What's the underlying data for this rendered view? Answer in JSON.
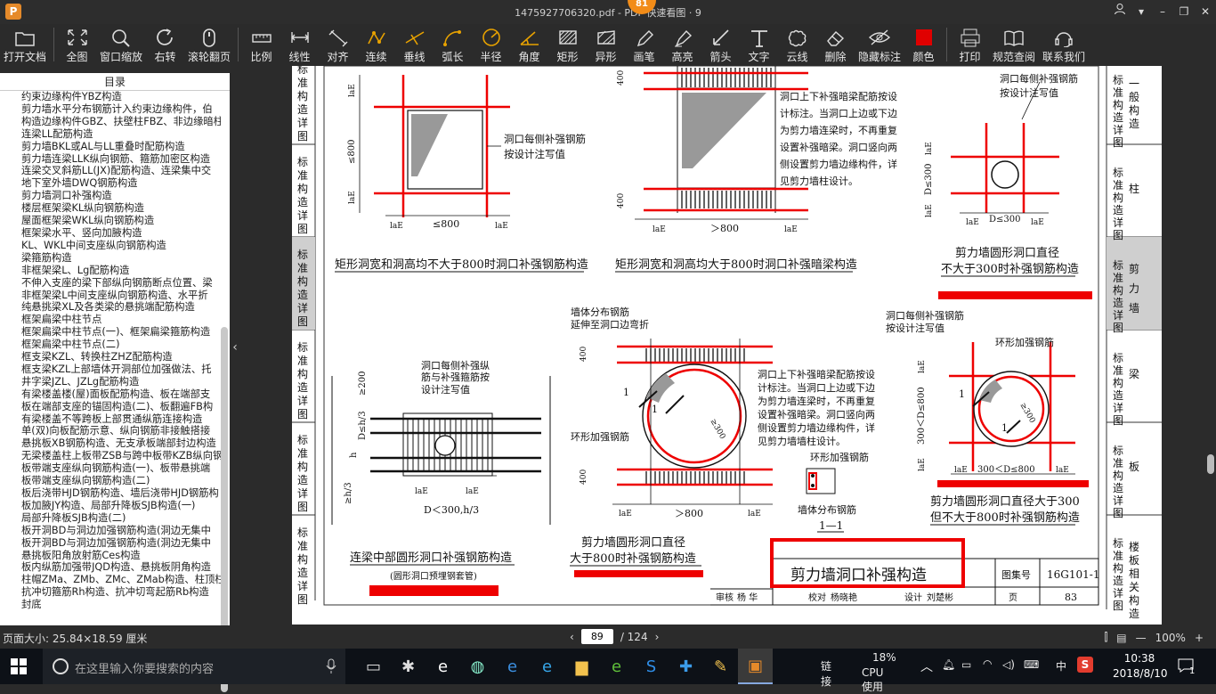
{
  "window": {
    "title": "1475927706320.pdf - PDF 快速看图 · 9",
    "badge": "81"
  },
  "toolbar": {
    "tools": [
      {
        "label": "打开文档",
        "icon": "folder-icon"
      },
      {
        "label": "全图",
        "icon": "fullscreen-icon"
      },
      {
        "label": "窗口缩放",
        "icon": "zoom-icon"
      },
      {
        "label": "右转",
        "icon": "rotate-right-icon"
      },
      {
        "label": "滚轮翻页",
        "icon": "mouse-wheel-icon"
      },
      {
        "label": "比例",
        "icon": "ruler-icon"
      },
      {
        "label": "线性",
        "icon": "linear-measure-icon"
      },
      {
        "label": "对齐",
        "icon": "aligned-measure-icon"
      },
      {
        "label": "连续",
        "icon": "continuous-measure-icon"
      },
      {
        "label": "垂线",
        "icon": "perpendicular-icon"
      },
      {
        "label": "弧长",
        "icon": "arc-length-icon"
      },
      {
        "label": "半径",
        "icon": "radius-icon"
      },
      {
        "label": "角度",
        "icon": "angle-icon"
      },
      {
        "label": "矩形",
        "icon": "rectangle-icon"
      },
      {
        "label": "异形",
        "icon": "polygon-icon"
      },
      {
        "label": "画笔",
        "icon": "pencil-icon"
      },
      {
        "label": "高亮",
        "icon": "highlighter-icon"
      },
      {
        "label": "箭头",
        "icon": "arrow-icon"
      },
      {
        "label": "文字",
        "icon": "text-icon"
      },
      {
        "label": "云线",
        "icon": "cloud-line-icon"
      },
      {
        "label": "删除",
        "icon": "eraser-icon"
      },
      {
        "label": "隐藏标注",
        "icon": "hide-eye-icon"
      },
      {
        "label": "颜色",
        "icon": "color-swatch-icon"
      },
      {
        "label": "打印",
        "icon": "printer-icon"
      },
      {
        "label": "规范查阅",
        "icon": "book-icon"
      },
      {
        "label": "联系我们",
        "icon": "headset-icon"
      }
    ],
    "color_swatch": "#e00000"
  },
  "sidebar": {
    "title": "目录",
    "items": [
      "约束边缘构件YBZ构造",
      "剪力墙水平分布钢筋计入约束边缘构件，伯",
      "构造边缘构件GBZ、扶壁柱FBZ、非边缘暗柱",
      "连梁LL配筋构造",
      "剪力墙BKL或AL与LL重叠时配筋构造",
      "剪力墙连梁LLK纵向钢筋、箍筋加密区构造",
      "连梁交叉斜筋LL(JX)配筋构造、连梁集中交",
      "地下室外墙DWQ钢筋构造",
      "剪力墙洞口补强构造",
      "楼层框架梁KL纵向钢筋构造",
      "屋面框架梁WKL纵向钢筋构造",
      "框架梁水平、竖向加腋构造",
      "KL、WKL中间支座纵向钢筋构造",
      "梁箍筋构造",
      "非框架梁L、Lg配筋构造",
      "不伸入支座的梁下部纵向钢筋断点位置、梁",
      "非框架梁L中间支座纵向钢筋构造、水平折",
      "纯悬挑梁XL及各类梁的悬挑端配筋构造",
      "框架扁梁中柱节点",
      "框架扁梁中柱节点(一)、框架扁梁箍筋构造",
      "框架扁梁中柱节点(二)",
      "框支梁KZL、转换柱ZHZ配筋构造",
      "框支梁KZL上部墙体开洞部位加强做法、托",
      "井字梁JZL、JZLg配筋构造",
      "有梁楼盖楼(屋)面板配筋构造、板在端部支",
      "板在端部支座的锚固构造(二)、板翻遍FB构",
      "有梁楼盖不等跨板上部贯通纵筋连接构造",
      "单(双)向板配筋示意、纵向钢筋非接触搭接",
      "悬挑板XB钢筋构造、无支承板端部封边构造",
      "无梁楼盖柱上板带ZSB与跨中板带KZB纵向钢",
      "板带端支座纵向钢筋构造(一)、板带悬挑端",
      "板带端支座纵向钢筋构造(二)",
      "板后浇带HJD钢筋构造、墙后浇带HJD钢筋构",
      "板加腋JY构造、局部升降板SJB构造(一)",
      "局部升降板SJB构造(二)",
      "板开洞BD与洞边加强钢筋构造(洞边无集中",
      "板开洞BD与洞边加强钢筋构造(洞边无集中",
      "悬挑板阳角放射筋Ces构造",
      "板内纵筋加强带JQD构造、悬挑板阴角构造",
      "柱帽ZMa、ZMb、ZMc、ZMab构造、柱顶柱帽",
      "抗冲切箍筋Rh构造、抗冲切弯起筋Rb构造",
      "封底"
    ]
  },
  "drawing": {
    "title_block": {
      "main_title": "剪力墙洞口补强构造",
      "atlas_label": "图集号",
      "atlas_no": "16G101-1",
      "review": "审核",
      "reviewer": "杨  华",
      "check": "校对",
      "checker": "杨晓艳",
      "design": "设计",
      "designer": "刘楚彬",
      "page_label": "页",
      "page_no": "83"
    },
    "side_tabs_left": [
      "标准构造详图",
      "标准构造详图",
      "标准构造详图",
      "标准构造详图",
      "标准构造详图",
      "标准构造详图"
    ],
    "side_tabs_right": [
      {
        "std": "标准构造详图",
        "name": "一般构造"
      },
      {
        "std": "标准构造详图",
        "name": "柱"
      },
      {
        "std": "标准构造详图",
        "name": "剪力墙"
      },
      {
        "std": "标准构造详图",
        "name": "梁"
      },
      {
        "std": "标准构造详图",
        "name": "板"
      },
      {
        "std": "标准构造详图",
        "name": "楼板相关构造"
      }
    ],
    "captions": {
      "rect_small": "矩形洞宽和洞高均不大于800时洞口补强钢筋构造",
      "rect_large": "矩形洞宽和洞高均大于800时洞口补强暗梁构造",
      "circle_300_l1": "剪力墙圆形洞口直径",
      "circle_300_l2": "不大于300时补强钢筋构造",
      "beam_circle": "连梁中部圆形洞口补强钢筋构造",
      "beam_circle_sub": "(圆形洞口预埋钢套管)",
      "circle_800_l1": "剪力墙圆形洞口直径",
      "circle_800_l2": "大于800时补强钢筋构造",
      "circle_mid_l1": "剪力墙圆形洞口直径大于300",
      "circle_mid_l2": "但不大于800时补强钢筋构造",
      "section": "1—1"
    },
    "notes": {
      "each_side_1": "洞口每侧补强钢筋",
      "each_side_2": "按设计注写值",
      "dark_beam": [
        "洞口上下补强暗梁配筋按设",
        "计标注。当洞口上边或下边",
        "为剪力墙连梁时，不再重复",
        "设置补强暗梁。洞口竖向两",
        "侧设置剪力墙边缘构件，详",
        "见剪力墙柱设计。"
      ],
      "dark_beam2": [
        "洞口上下补强暗梁配筋按设",
        "计标注。当洞口上边或下边",
        "为剪力墙连梁时，不再重复",
        "设置补强暗梁。洞口竖向两",
        "侧设置剪力墙边缘构件，详",
        "见剪力墙墙柱设计。"
      ],
      "beam_note": [
        "洞口每侧补强纵",
        "筋与补强箍筋按",
        "设计注写值"
      ],
      "wall_dist_1": "墙体分布钢筋",
      "wall_dist_2": "延伸至洞口边弯折",
      "ring": "环形加强钢筋",
      "wall_dist": "墙体分布钢筋"
    },
    "dims": {
      "lae": "laE",
      "le800": "≤800",
      "gt800": "＞800",
      "le800v": "≤800",
      "d400": "400",
      "d300": "D≤300",
      "d_lt300": "D＜300,h/3",
      "d_range": "300＜D≤800",
      "h": "h",
      "h3": "≥h/3",
      "dh3": "D≤h/3",
      "ge200": "≥200",
      "ge300": "≥300",
      "le300": "≤300",
      "num1": "1"
    }
  },
  "status": {
    "page_size": "页面大小: 25.84×18.59 厘米",
    "current_page": "89",
    "total_pages": "/ 124",
    "zoom": "100%"
  },
  "taskbar": {
    "search_placeholder": "在这里输入你要搜索的内容",
    "link": "链接",
    "cpu_pct": "18%",
    "cpu_label": "CPU使用",
    "ime": "中",
    "time": "10:38",
    "date": "2018/8/10",
    "notif_count": "1"
  }
}
